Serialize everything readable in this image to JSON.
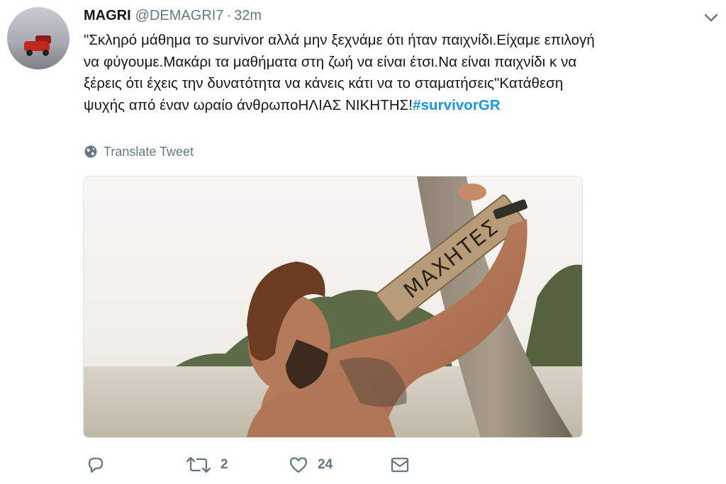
{
  "tweet": {
    "display_name": "MAGRI",
    "handle": "@DEMAGRI7",
    "separator": "·",
    "time_ago": "32m",
    "text_lines": [
      "\"Σκληρό μάθημα το survivor αλλά μην ξεχνάμε ότι ήταν παιχνίδι.Είχαμε επιλογή",
      "να φύγουμε.Μακάρι τα μαθήματα στη ζωή να είναι έτσι.Να είναι παιχνίδι κ να",
      "ξέρεις ότι έχεις την δυνατότητα να κάνεις κάτι να το σταματήσεις\"Κατάθεση",
      "ψυχής από έναν ωραίο άνθρωποΗΛΙΑΣ ΝΙΚΗΤΗΣ!"
    ],
    "hashtag": "#survivorGR",
    "translate_label": "Translate Tweet",
    "media": {
      "sign_text": "ΜΑΧΗΤΕΣ"
    },
    "actions": {
      "reply_count": "",
      "retweet_count": "2",
      "like_count": "24"
    }
  },
  "colors": {
    "link": "#1b95e0",
    "secondary_text": "#657786",
    "primary_text": "#14171a"
  },
  "icons": [
    "chevron-down-icon",
    "globe-icon",
    "reply-icon",
    "retweet-icon",
    "like-icon",
    "message-icon"
  ]
}
